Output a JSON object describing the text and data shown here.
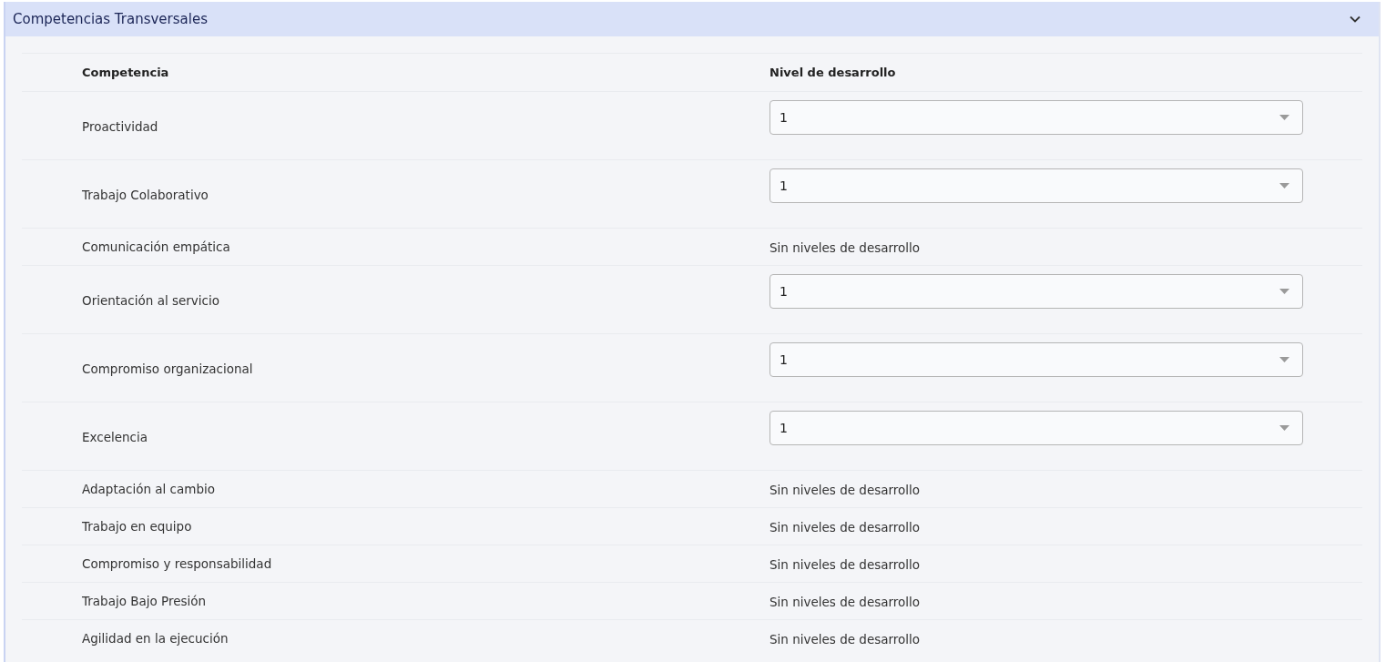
{
  "panel": {
    "title": "Competencias Transversales",
    "expanded": true
  },
  "table": {
    "columns": [
      "Competencia",
      "Nivel de desarrollo"
    ],
    "rows": [
      {
        "competencia": "Proactividad",
        "kind": "select",
        "value": "1"
      },
      {
        "competencia": "Trabajo Colaborativo",
        "kind": "select",
        "value": "1"
      },
      {
        "competencia": "Comunicación empática",
        "kind": "text",
        "value": "Sin niveles de desarrollo"
      },
      {
        "competencia": "Orientación al servicio",
        "kind": "select",
        "value": "1"
      },
      {
        "competencia": "Compromiso organizacional",
        "kind": "select",
        "value": "1"
      },
      {
        "competencia": "Excelencia",
        "kind": "select",
        "value": "1"
      },
      {
        "competencia": "Adaptación al cambio",
        "kind": "text",
        "value": "Sin niveles de desarrollo"
      },
      {
        "competencia": "Trabajo en equipo",
        "kind": "text",
        "value": "Sin niveles de desarrollo"
      },
      {
        "competencia": "Compromiso y responsabilidad",
        "kind": "text",
        "value": "Sin niveles de desarrollo"
      },
      {
        "competencia": "Trabajo Bajo Presión",
        "kind": "text",
        "value": "Sin niveles de desarrollo"
      },
      {
        "competencia": "Agilidad en la ejecución",
        "kind": "text",
        "value": "Sin niveles de desarrollo"
      }
    ]
  }
}
